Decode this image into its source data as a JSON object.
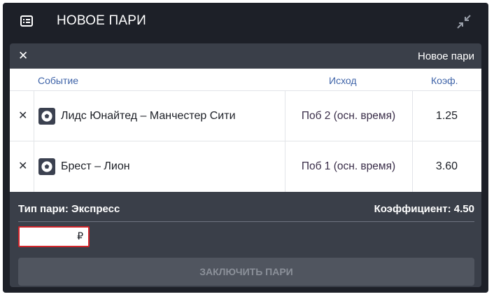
{
  "header": {
    "title": "НОВОЕ ПАРИ"
  },
  "card": {
    "title": "Новое пари"
  },
  "table": {
    "columns": {
      "event": "Событие",
      "outcome": "Исход",
      "coef": "Коэф."
    },
    "rows": [
      {
        "event": "Лидс Юнайтед – Манчестер Сити",
        "outcome": "Поб 2 (осн. время)",
        "coef": "1.25"
      },
      {
        "event": "Брест – Лион",
        "outcome": "Поб 1 (осн. время)",
        "coef": "3.60"
      }
    ]
  },
  "summary": {
    "bet_type": "Тип пари: Экспресс",
    "coefficient": "Коэффициент: 4.50"
  },
  "stake": {
    "value": "",
    "currency": "₽"
  },
  "submit": {
    "label": "ЗАКЛЮЧИТЬ ПАРИ"
  },
  "icons": {
    "header": "betslip-icon",
    "collapse": "collapse-icon",
    "sport": "football-icon"
  },
  "colors": {
    "panel_bg": "#1d2028",
    "card_bg": "#3a3f49",
    "header_link": "#3e63a8",
    "stake_border": "#d0262c"
  }
}
